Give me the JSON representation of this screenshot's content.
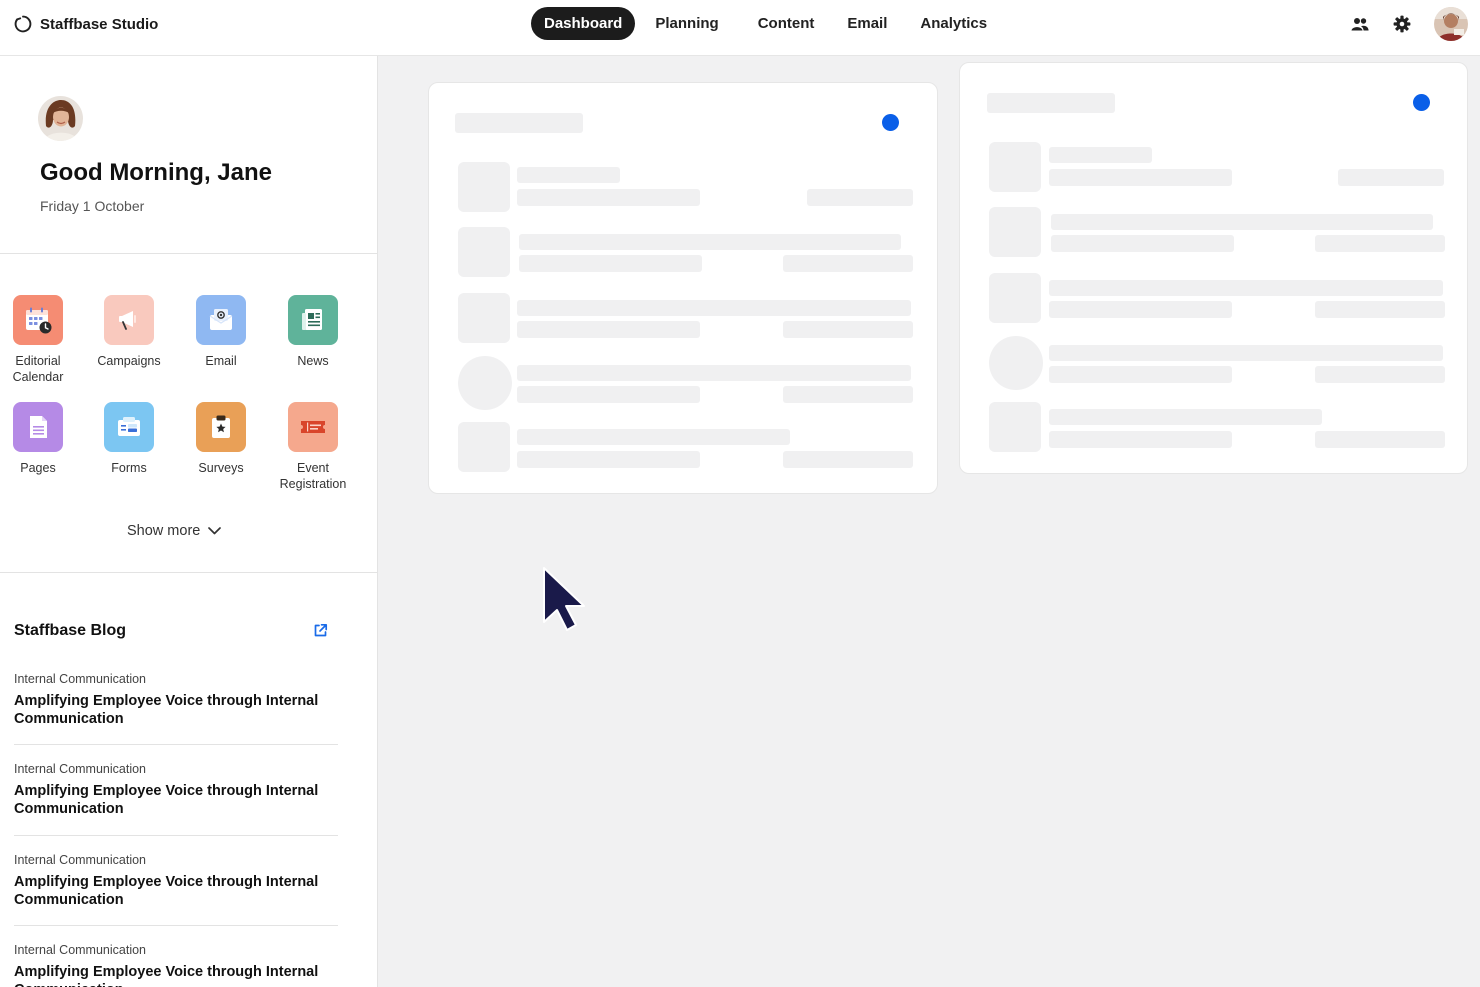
{
  "app": {
    "title": "Staffbase Studio"
  },
  "nav": {
    "tabs": [
      {
        "label": "Dashboard",
        "active": true
      },
      {
        "label": "Planning",
        "active": false
      },
      {
        "label": "Content",
        "active": false
      },
      {
        "label": "Email",
        "active": false
      },
      {
        "label": "Analytics",
        "active": false
      }
    ]
  },
  "header_icons": [
    "users-icon",
    "gear-icon",
    "profile-avatar"
  ],
  "greeting": {
    "title": "Good Morning, Jane",
    "date": "Friday 1 October"
  },
  "apps": {
    "items": [
      {
        "label": "Editorial Calendar",
        "icon": "calendar-clock-icon",
        "color": "#f58c73"
      },
      {
        "label": "Campaigns",
        "icon": "megaphone-icon",
        "color": "#f9c9be"
      },
      {
        "label": "Email",
        "icon": "email-at-icon",
        "color": "#8fb8f2"
      },
      {
        "label": "News",
        "icon": "newspaper-icon",
        "color": "#5fb39a"
      },
      {
        "label": "Pages",
        "icon": "page-icon",
        "color": "#b58ae6"
      },
      {
        "label": "Forms",
        "icon": "form-icon",
        "color": "#7cc6f2"
      },
      {
        "label": "Surveys",
        "icon": "clipboard-star-icon",
        "color": "#e9a057"
      },
      {
        "label": "Event Registration",
        "icon": "ticket-icon",
        "color": "#f5a88d"
      }
    ],
    "show_more_label": "Show more"
  },
  "blog": {
    "title": "Staffbase Blog",
    "items": [
      {
        "category": "Internal Communication",
        "headline": "Amplifying Employee Voice through Internal Communication"
      },
      {
        "category": "Internal Communication",
        "headline": "Amplifying Employee Voice through Internal Communication"
      },
      {
        "category": "Internal Communication",
        "headline": "Amplifying Employee Voice through Internal Communication"
      },
      {
        "category": "Internal Communication",
        "headline": "Amplifying Employee Voice through Internal Communication"
      }
    ]
  },
  "colors": {
    "accent": "#0a5fe8",
    "active_tab_bg": "#1c1c1c",
    "background": "#f1f1f2",
    "skeleton": "#f0f0f1"
  }
}
